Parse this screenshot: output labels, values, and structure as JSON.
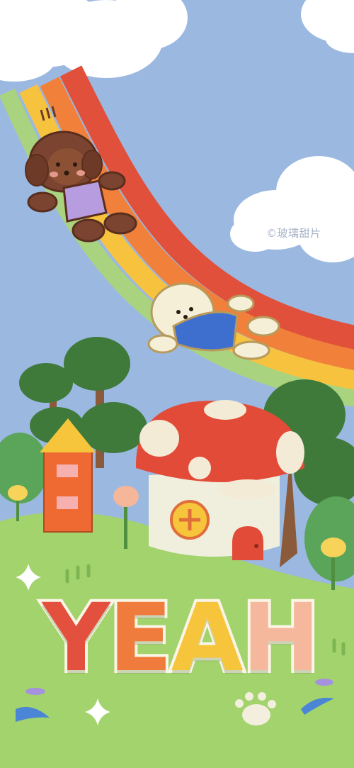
{
  "watermark": "©玻璃甜片",
  "headline": {
    "letters": [
      "Y",
      "E",
      "A",
      "H"
    ],
    "colors": [
      "#e4503e",
      "#ef7c3c",
      "#f7c53b",
      "#f6b89d"
    ]
  },
  "palette": {
    "sky": "#9bb8e0",
    "grass": "#a3d36c",
    "rainbow": [
      "#e0503b",
      "#f0803a",
      "#f7c33e",
      "#a9d37f"
    ],
    "mushroom_cap": "#e34b39",
    "house_wall": "#f0eedd",
    "tower_wall": "#ef6a33",
    "tower_roof": "#f7c53b"
  },
  "icons": [
    "cloud",
    "rainbow",
    "brown-poodle",
    "white-poodle",
    "mushroom-house",
    "tower-house",
    "tree",
    "tulip",
    "sparkle",
    "paw-print"
  ]
}
